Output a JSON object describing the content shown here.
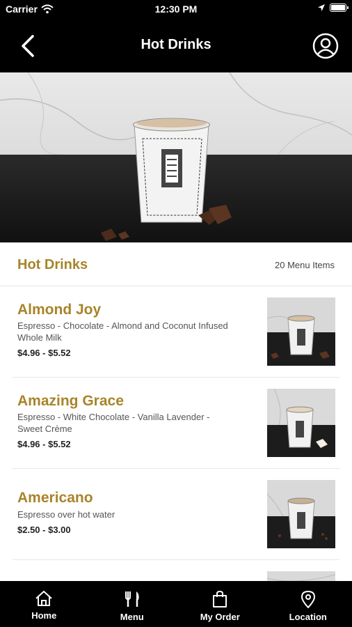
{
  "status_bar": {
    "carrier": "Carrier",
    "time": "12:30 PM"
  },
  "nav": {
    "title": "Hot Drinks",
    "back_icon": "chevron-left-icon",
    "profile_icon": "user-circle-icon"
  },
  "section": {
    "title": "Hot Drinks",
    "count": "20 Menu Items"
  },
  "menu_items": [
    {
      "name": "Almond Joy",
      "description": "Espresso - Chocolate - Almond and Coconut Infused Whole Milk",
      "price": "$4.96 - $5.52"
    },
    {
      "name": "Amazing Grace",
      "description": "Espresso - White Chocolate - Vanilla Lavender - Sweet Crème",
      "price": "$4.96 - $5.52"
    },
    {
      "name": "Americano",
      "description": "Espresso over hot water",
      "price": "$2.50 - $3.00"
    }
  ],
  "tabs": [
    {
      "label": "Home",
      "icon": "home-icon"
    },
    {
      "label": "Menu",
      "icon": "fork-knife-icon"
    },
    {
      "label": "My Order",
      "icon": "shopping-bag-icon"
    },
    {
      "label": "Location",
      "icon": "map-pin-icon"
    }
  ],
  "colors": {
    "accent": "#a8842a",
    "bar": "#000000"
  }
}
